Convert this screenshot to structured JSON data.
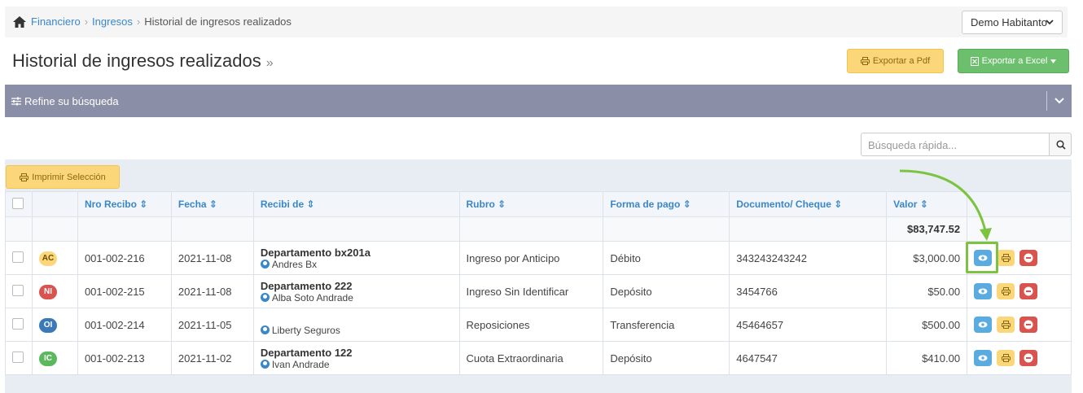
{
  "breadcrumb": {
    "items": [
      "Financiero",
      "Ingresos",
      "Historial de ingresos realizados"
    ]
  },
  "user_select": {
    "value": "Demo Habitanto"
  },
  "page": {
    "title": "Historial de ingresos realizados",
    "title_suffix": "»"
  },
  "toolbar": {
    "pdf_label": "Exportar a Pdf",
    "excel_label": "Exportar a Excel"
  },
  "refine": {
    "label": "Refine su búsqueda"
  },
  "search": {
    "placeholder": "Búsqueda rápida..."
  },
  "print_selection": {
    "label": "Imprimir Selección"
  },
  "table": {
    "headers": [
      "Nro Recibo",
      "Fecha",
      "Recibi de",
      "Rubro",
      "Forma de pago",
      "Documento/ Cheque",
      "Valor"
    ],
    "total": "$83,747.52",
    "rows": [
      {
        "badge": "AC",
        "badge_color": "#fcd77a",
        "recibo": "001-002-216",
        "fecha": "2021-11-08",
        "dept": "Departamento bx201a",
        "person": "Andres Bx",
        "rubro": "Ingreso por Anticipo",
        "forma": "Débito",
        "doc": "343243243242",
        "valor": "$3,000.00"
      },
      {
        "badge": "NI",
        "badge_color": "#d9534f",
        "recibo": "001-002-215",
        "fecha": "2021-11-08",
        "dept": "Departamento 222",
        "person": "Alba Soto Andrade",
        "rubro": "Ingreso Sin Identificar",
        "forma": "Depósito",
        "doc": "3454766",
        "valor": "$50.00"
      },
      {
        "badge": "OI",
        "badge_color": "#3a7ab8",
        "recibo": "001-002-214",
        "fecha": "2021-11-05",
        "dept": "",
        "person": "Liberty Seguros",
        "rubro": "Reposiciones",
        "forma": "Transferencia",
        "doc": "45464657",
        "valor": "$500.00"
      },
      {
        "badge": "IC",
        "badge_color": "#5cb85c",
        "recibo": "001-002-213",
        "fecha": "2021-11-02",
        "dept": "Departamento 122",
        "person": "Ivan Andrade",
        "rubro": "Cuota Extraordinaria",
        "forma": "Depósito",
        "doc": "4647547",
        "valor": "$410.00"
      }
    ]
  },
  "colors": {
    "accent": "#3a87c8",
    "refine_bar": "#8a8ea6",
    "highlight": "#7cc342"
  }
}
